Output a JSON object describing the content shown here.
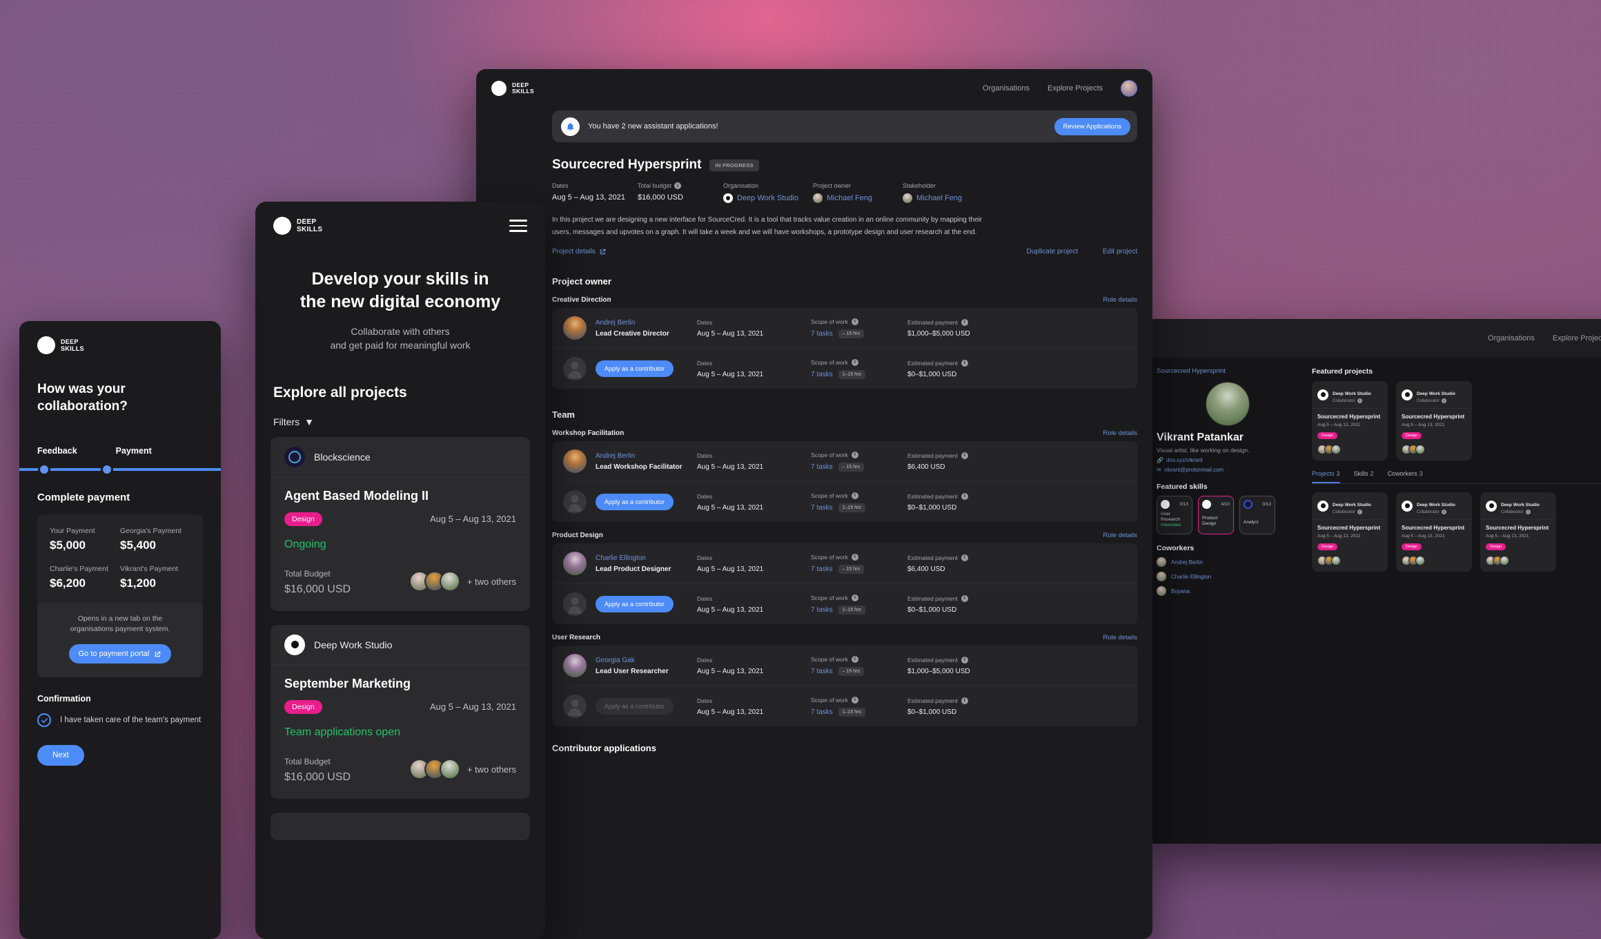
{
  "brand": {
    "line1": "DEEP",
    "line2": "SKILLS"
  },
  "project_window": {
    "nav": {
      "organisations": "Organisations",
      "explore": "Explore Projects"
    },
    "banner": {
      "text": "You have 2 new assistant applications!",
      "button": "Review Applications"
    },
    "title": "Sourcecred Hypersprint",
    "status": "IN PROGRESS",
    "meta": [
      {
        "label": "Dates",
        "value": "Aug 5 – Aug 13, 2021",
        "info": false,
        "kind": "plain"
      },
      {
        "label": "Total budget",
        "value": "$16,000 USD",
        "info": true,
        "kind": "plain"
      },
      {
        "label": "Organisation",
        "value": "Deep Work Studio",
        "info": false,
        "kind": "org"
      },
      {
        "label": "Project owner",
        "value": "Michael Feng",
        "info": false,
        "kind": "person"
      },
      {
        "label": "Stakeholder",
        "value": "Michael Feng",
        "info": false,
        "kind": "person"
      }
    ],
    "description": "In this project we are designing a new interface for SourceCred. It is a tool that tracks value creation in an online community by mapping their users, messages and upvotes on a graph. It will take a week and we will have workshops, a prototype design and user research at the end.",
    "links": {
      "details": "Project details",
      "duplicate": "Duplicate project",
      "edit": "Edit project"
    },
    "sections": [
      {
        "title": "Project owner",
        "roles": [
          {
            "name": "Creative Direction",
            "role_details": "Role details",
            "rows": [
              {
                "type": "member",
                "person": "Andrej Berlin",
                "role": "Lead Creative Director",
                "dates_label": "Dates",
                "dates": "Aug 5 – Aug 13, 2021",
                "scope_label": "Scope of work",
                "tasks": "7 tasks",
                "hours": "– 15 hrs",
                "pay_label": "Estimated payment",
                "pay": "$1,000–$5,000 USD",
                "avatar": "p1"
              },
              {
                "type": "apply",
                "button": "Apply as a contributor",
                "disabled": false,
                "dates_label": "Dates",
                "dates": "Aug 5 – Aug 13, 2021",
                "scope_label": "Scope of work",
                "tasks": "7 tasks",
                "hours": "1–15 hrs",
                "pay_label": "Estimated payment",
                "pay": "$0–$1,000 USD"
              }
            ]
          }
        ]
      },
      {
        "title": "Team",
        "roles": [
          {
            "name": "Workshop Facilitation",
            "role_details": "Role details",
            "rows": [
              {
                "type": "member",
                "person": "Andrej Berlin",
                "role": "Lead Workshop Facilitator",
                "dates_label": "Dates",
                "dates": "Aug 5 – Aug 13, 2021",
                "scope_label": "Scope of work",
                "tasks": "7 tasks",
                "hours": "– 15 hrs",
                "pay_label": "Estimated payment",
                "pay": "$6,400 USD",
                "avatar": "p1"
              },
              {
                "type": "apply",
                "button": "Apply as a contributor",
                "disabled": false,
                "dates_label": "Dates",
                "dates": "Aug 5 – Aug 13, 2021",
                "scope_label": "Scope of work",
                "tasks": "7 tasks",
                "hours": "1–15 hrs",
                "pay_label": "Estimated payment",
                "pay": "$0–$1,000 USD"
              }
            ]
          },
          {
            "name": "Product Design",
            "role_details": "Role details",
            "rows": [
              {
                "type": "member",
                "person": "Charlie Ellington",
                "role": "Lead Product Designer",
                "dates_label": "Dates",
                "dates": "Aug 5 – Aug 13, 2021",
                "scope_label": "Scope of work",
                "tasks": "7 tasks",
                "hours": "– 15 hrs",
                "pay_label": "Estimated payment",
                "pay": "$6,400 USD",
                "avatar": "p2"
              },
              {
                "type": "apply",
                "button": "Apply as a contributor",
                "disabled": false,
                "dates_label": "Dates",
                "dates": "Aug 5 – Aug 13, 2021",
                "scope_label": "Scope of work",
                "tasks": "7 tasks",
                "hours": "1–15 hrs",
                "pay_label": "Estimated payment",
                "pay": "$0–$1,000 USD"
              }
            ]
          },
          {
            "name": "User Research",
            "role_details": "Role details",
            "rows": [
              {
                "type": "member",
                "person": "Georgia Gak",
                "role": "Lead User Researcher",
                "dates_label": "Dates",
                "dates": "Aug 5 – Aug 13, 2021",
                "scope_label": "Scope of work",
                "tasks": "7 tasks",
                "hours": "– 15 hrs",
                "pay_label": "Estimated payment",
                "pay": "$1,000–$5,000 USD",
                "avatar": "p2"
              },
              {
                "type": "apply",
                "button": "Apply as a contributor",
                "disabled": true,
                "dates_label": "Dates",
                "dates": "Aug 5 – Aug 13, 2021",
                "scope_label": "Scope of work",
                "tasks": "7 tasks",
                "hours": "1–15 hrs",
                "pay_label": "Estimated payment",
                "pay": "$0–$1,000 USD"
              }
            ]
          }
        ]
      }
    ],
    "contributor_applications": "Contributor applications"
  },
  "explore_window": {
    "headline": "Develop your skills in\nthe new digital economy",
    "headline_l1": "Develop your skills in",
    "headline_l2": "the new digital economy",
    "sub_l1": "Collaborate with others",
    "sub_l2": "and get paid for meaningful work",
    "section_title": "Explore all projects",
    "filters": "Filters",
    "cards": [
      {
        "org": "Blockscience",
        "logo": "blockscience-logo",
        "title": "Agent Based Modeling II",
        "tag": "Design",
        "dates": "Aug 5 – Aug 13, 2021",
        "status": "Ongoing",
        "budget_label": "Total Budget",
        "budget": "$16,000",
        "currency": "USD",
        "others": "+ two others"
      },
      {
        "org": "Deep Work Studio",
        "logo": "deep-work-logo",
        "title": "September Marketing",
        "tag": "Design",
        "dates": "Aug 5 – Aug 13, 2021",
        "status": "Team applications open",
        "budget_label": "Total Budget",
        "budget": "$16,000",
        "currency": "USD",
        "others": "+ two others"
      }
    ]
  },
  "payment_window": {
    "question_l1": "How was your",
    "question_l2": "collaboration?",
    "steps": [
      {
        "label": "Feedback"
      },
      {
        "label": "Payment"
      }
    ],
    "section": "Complete payment",
    "payments": [
      {
        "label": "Your Payment",
        "amount": "$5,000"
      },
      {
        "label": "Georgia's Payment",
        "amount": "$5,400"
      },
      {
        "label": "Charlie's Payment",
        "amount": "$6,200"
      },
      {
        "label": "Vikrant's Payment",
        "amount": "$1,200"
      }
    ],
    "portal_note_l1": "Opens in a new tab on the",
    "portal_note_l2": "organisations payment system.",
    "portal_button": "Go to payment portal",
    "confirmation_title": "Confirmation",
    "confirmation_text": "I have taken care of the team's payment",
    "next_button": "Next"
  },
  "profile_window": {
    "nav": {
      "organisations": "Organisations",
      "explore": "Explore Projects"
    },
    "breadcrumb": "Sourcecred Hypersprint",
    "name": "Vikrant Patankar",
    "bio": "Visual artist, like working on design.",
    "link": "dns.xyz/vikrant",
    "email": "vikrant@protonmail.com",
    "skills_title": "Featured skills",
    "skills": [
      {
        "label_l1": "User",
        "label_l2": "Research",
        "state": "Interested",
        "fraction": "0/13",
        "highlight": false,
        "icon": "deep-work-logo"
      },
      {
        "label_l1": "Product",
        "label_l2": "Design",
        "state": "",
        "fraction": "4/10",
        "highlight": true,
        "icon": "deep-work-logo"
      },
      {
        "label_l1": "Analyst",
        "label_l2": "",
        "state": "",
        "fraction": "0/13",
        "highlight": false,
        "icon": "blockscience-logo"
      }
    ],
    "coworkers_title": "Coworkers",
    "coworkers": [
      {
        "name": "Andrej Berlin"
      },
      {
        "name": "Charlie Ellington"
      },
      {
        "name": "Boyana"
      }
    ],
    "featured_title": "Featured projects",
    "tabs": [
      {
        "label": "Projects",
        "count": "3",
        "active": true
      },
      {
        "label": "Skills",
        "count": "2",
        "active": false
      },
      {
        "label": "Coworkers",
        "count": "3",
        "active": false
      }
    ],
    "featured_projects": [
      {
        "org": "Deep Work Studio",
        "role": "Collaborator",
        "title": "Sourcecred Hypersprint",
        "dates": "Aug 5 – Aug 13, 2021",
        "tag": "Design"
      },
      {
        "org": "Deep Work Studio",
        "role": "Collaborator",
        "title": "Sourcecred Hypersprint",
        "dates": "Aug 5 – Aug 13, 2021",
        "tag": "Design"
      }
    ],
    "tab_projects": [
      {
        "org": "Deep Work Studio",
        "role": "Collaborator",
        "title": "Sourcecred Hypersprint",
        "dates": "Aug 5 – Aug 13, 2021",
        "tag": "Design"
      },
      {
        "org": "Deep Work Studio",
        "role": "Collaborator",
        "title": "Sourcecred Hypersprint",
        "dates": "Aug 5 – Aug 13, 2021",
        "tag": "Design"
      },
      {
        "org": "Deep Work Studio",
        "role": "Collaborator",
        "title": "Sourcecred Hypersprint",
        "dates": "Aug 5 – Aug 13, 2021",
        "tag": "Design"
      }
    ]
  },
  "colors": {
    "accent_blue": "#4d8bf8",
    "link_blue": "#6f92d8",
    "pink": "#e91e8c",
    "green": "#23c36a"
  }
}
